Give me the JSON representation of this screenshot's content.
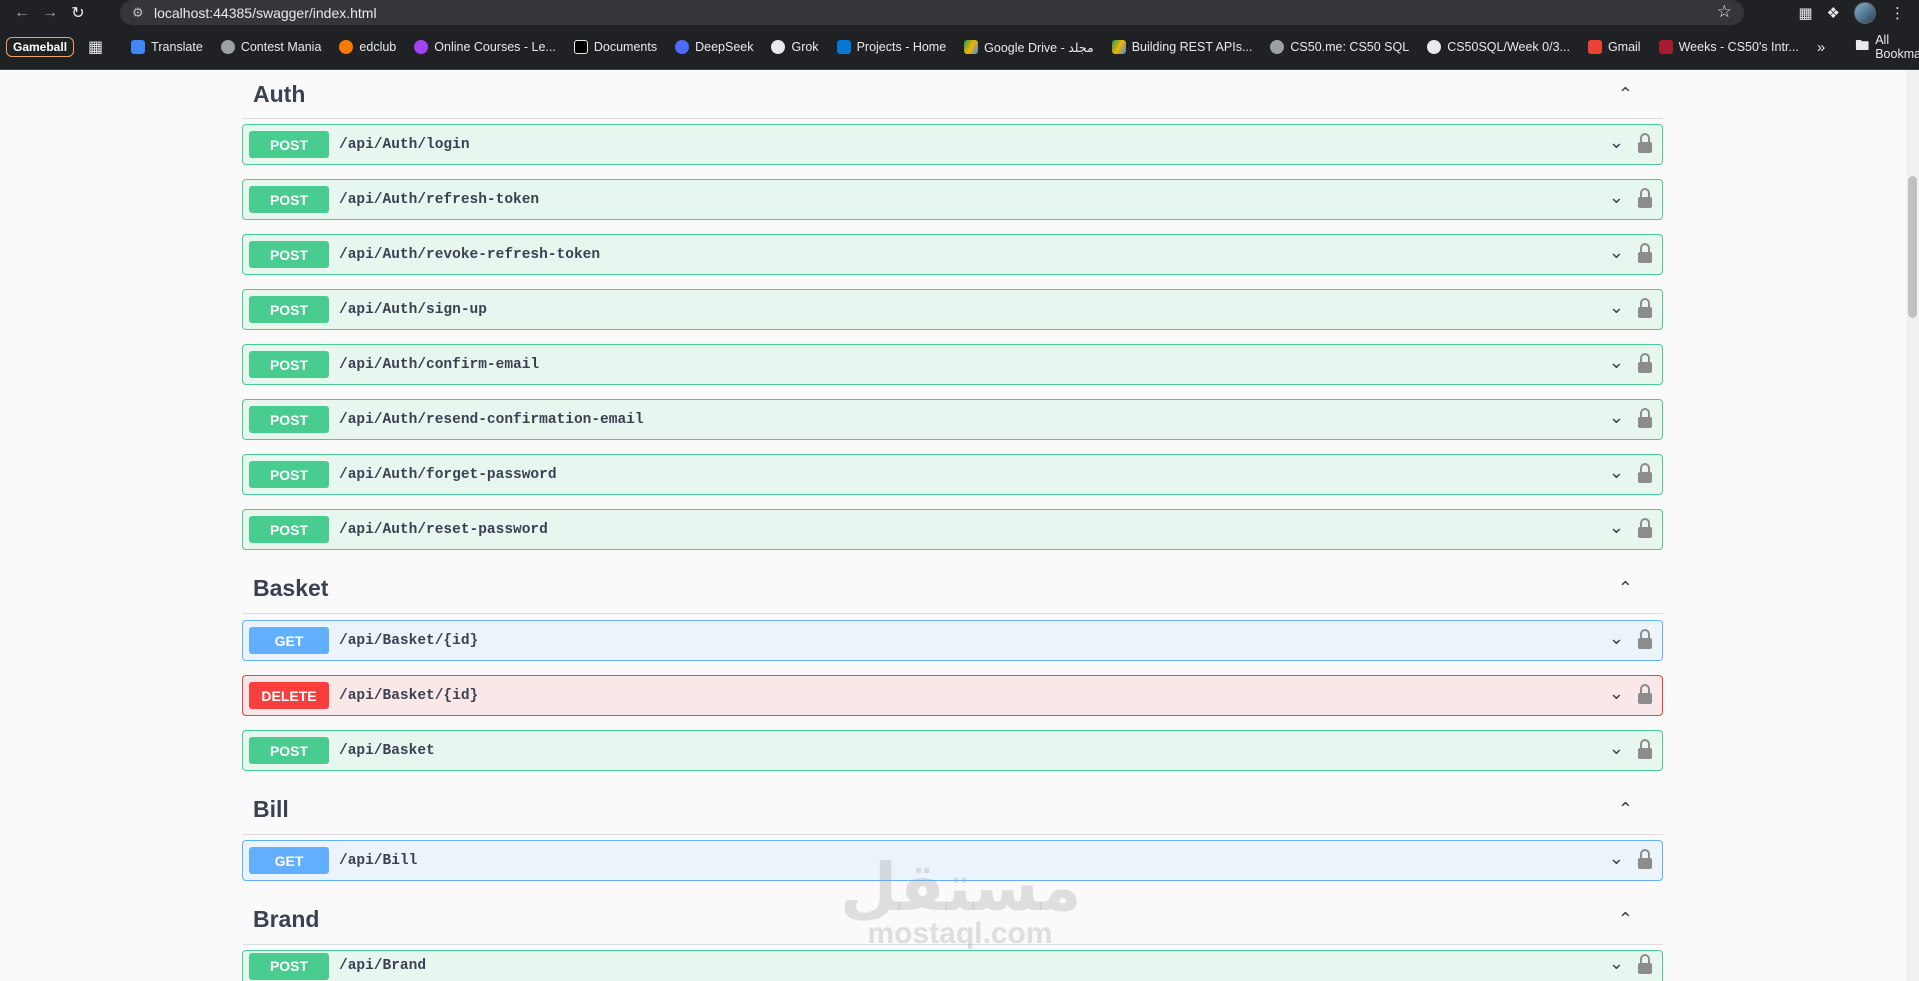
{
  "browser": {
    "url": "localhost:44385/swagger/index.html",
    "bookmarks": {
      "gameball": "Gameball",
      "items": [
        "Translate",
        "Contest Mania",
        "edclub",
        "Online Courses - Le...",
        "Documents",
        "DeepSeek",
        "Grok",
        "Projects - Home",
        "Google Drive - مجلد",
        "Building REST APIs...",
        "CS50.me: CS50 SQL",
        "CS50SQL/Week 0/3...",
        "Gmail",
        "Weeks - CS50's Intr..."
      ],
      "all_bookmarks": "All Bookmarks"
    }
  },
  "sections": {
    "auth": {
      "title": "Auth",
      "ops": [
        {
          "method": "POST",
          "path": "/api/Auth/login"
        },
        {
          "method": "POST",
          "path": "/api/Auth/refresh-token"
        },
        {
          "method": "POST",
          "path": "/api/Auth/revoke-refresh-token"
        },
        {
          "method": "POST",
          "path": "/api/Auth/sign-up"
        },
        {
          "method": "POST",
          "path": "/api/Auth/confirm-email"
        },
        {
          "method": "POST",
          "path": "/api/Auth/resend-confirmation-email"
        },
        {
          "method": "POST",
          "path": "/api/Auth/forget-password"
        },
        {
          "method": "POST",
          "path": "/api/Auth/reset-password"
        }
      ]
    },
    "basket": {
      "title": "Basket",
      "ops": [
        {
          "method": "GET",
          "path": "/api/Basket/{id}"
        },
        {
          "method": "DELETE",
          "path": "/api/Basket/{id}"
        },
        {
          "method": "POST",
          "path": "/api/Basket"
        }
      ]
    },
    "bill": {
      "title": "Bill",
      "ops": [
        {
          "method": "GET",
          "path": "/api/Bill"
        }
      ]
    },
    "brand": {
      "title": "Brand",
      "ops": [
        {
          "method": "POST",
          "path": "/api/Brand"
        }
      ]
    }
  },
  "watermark": {
    "arabic": "مستقل",
    "latin": "mostaql.com"
  },
  "colors": {
    "post": "#49cc90",
    "get": "#61affe",
    "delete": "#f93e3e"
  }
}
